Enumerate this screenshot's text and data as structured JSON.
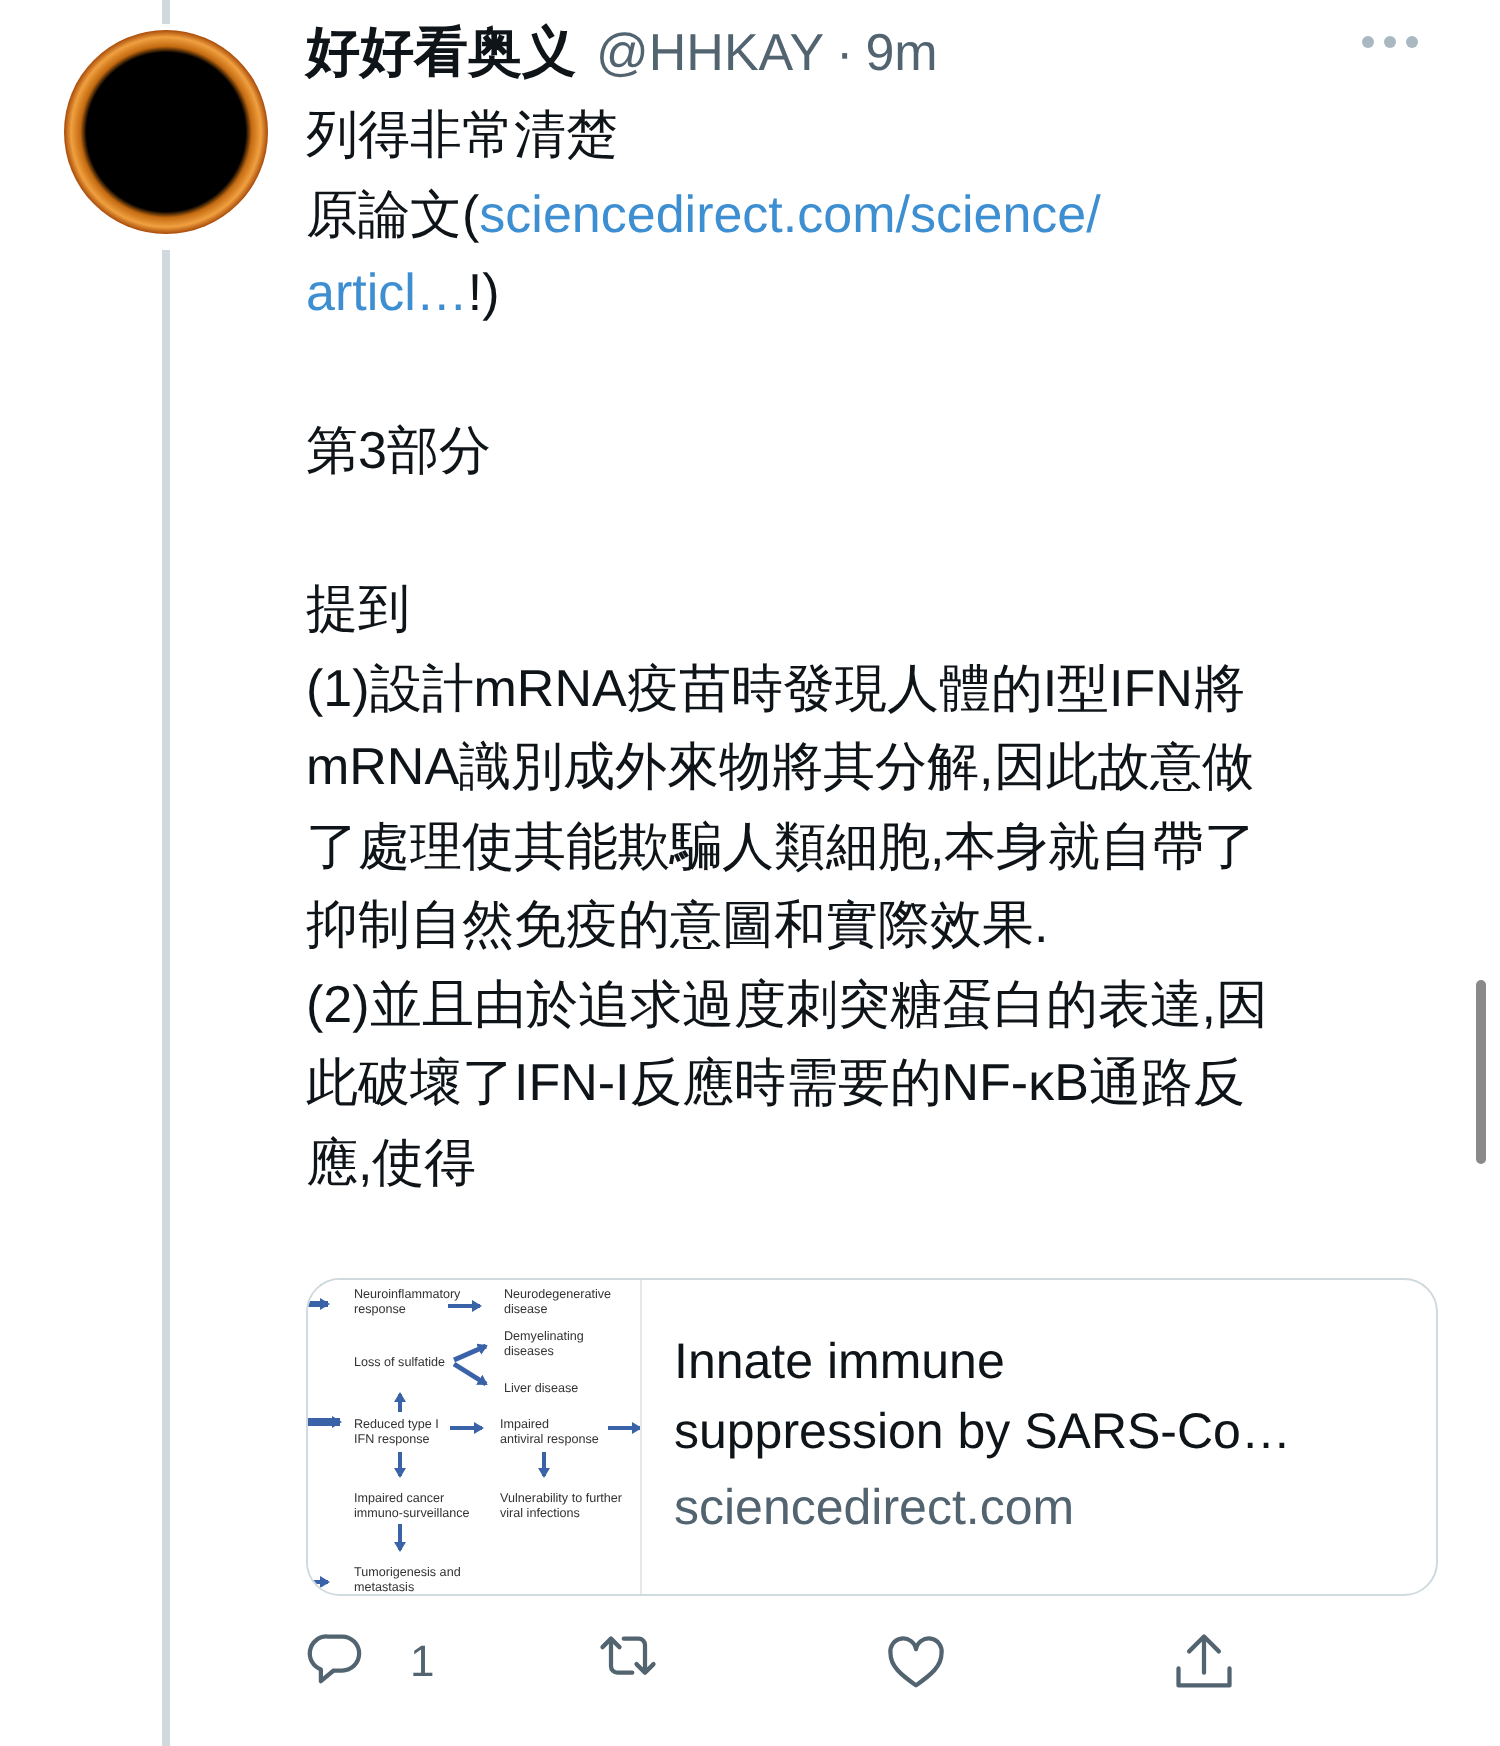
{
  "author": {
    "name": "好好看奥义",
    "handle": "@HHKAY",
    "separator": "·",
    "time": "9m"
  },
  "body": [
    [
      [
        {
          "kind": "text",
          "text": "列得非常清楚"
        }
      ],
      [
        {
          "kind": "text",
          "text": "原論文("
        },
        {
          "kind": "link",
          "text": "sciencedirect.com/science/"
        }
      ],
      [
        {
          "kind": "link",
          "text": "articl…"
        },
        {
          "kind": "text",
          "text": "!)"
        }
      ]
    ],
    [
      [
        {
          "kind": "text",
          "text": "第3部分"
        }
      ]
    ],
    [
      [
        {
          "kind": "text",
          "text": "提到"
        }
      ],
      [
        {
          "kind": "text",
          "text": "(1)設計mRNA疫苗時發現人體的I型IFN將"
        }
      ],
      [
        {
          "kind": "text",
          "text": "mRNA識別成外來物將其分解,因此故意做"
        }
      ],
      [
        {
          "kind": "text",
          "text": "了處理使其能欺騙人類細胞,本身就自帶了"
        }
      ],
      [
        {
          "kind": "text",
          "text": "抑制自然免疫的意圖和實際效果."
        }
      ],
      [
        {
          "kind": "text",
          "text": "(2)並且由於追求過度刺突糖蛋白的表達,因"
        }
      ],
      [
        {
          "kind": "text",
          "text": "此破壞了IFN-I反應時需要的NF-κB通路反"
        }
      ],
      [
        {
          "kind": "text",
          "text": "應,使得"
        }
      ]
    ]
  ],
  "card": {
    "figure": {
      "labels": [
        {
          "lines": [
            "Neuroinflammatory",
            "response"
          ]
        },
        {
          "lines": [
            "Neurodegenerative",
            "disease"
          ]
        },
        {
          "lines": [
            "Demyelinating",
            "diseases"
          ]
        },
        {
          "lines": [
            "Loss of sulfatide"
          ]
        },
        {
          "lines": [
            "Liver disease"
          ]
        },
        {
          "lines": [
            "Reduced type I",
            "IFN response"
          ]
        },
        {
          "lines": [
            "Impaired",
            "antiviral response"
          ]
        },
        {
          "lines": [
            "Impaired cancer",
            "immuno-surveillance"
          ]
        },
        {
          "lines": [
            "Vulnerability to further",
            "viral infections"
          ]
        },
        {
          "lines": [
            "Tumorigenesis and",
            "metastasis"
          ]
        }
      ]
    },
    "title": [
      "Innate immune",
      "suppression by SARS-Co…"
    ],
    "domain": "sciencedirect.com"
  },
  "actions": [
    {
      "kind": "reply",
      "count": "1"
    },
    {
      "kind": "retweet"
    },
    {
      "kind": "like"
    },
    {
      "kind": "share"
    }
  ]
}
